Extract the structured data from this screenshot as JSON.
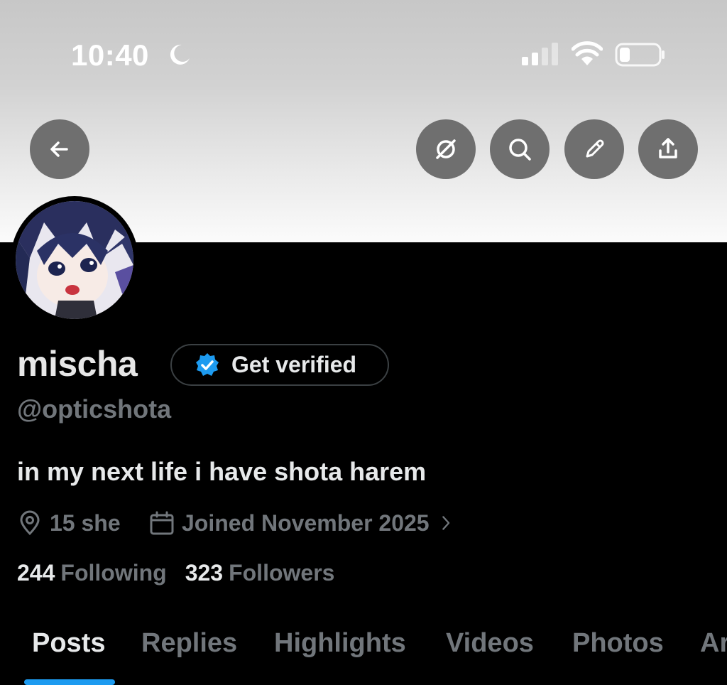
{
  "status_bar": {
    "time": "10:40",
    "moon_icon": "moon-icon",
    "signal_icon": "cellular-signal-icon",
    "wifi_icon": "wifi-icon",
    "battery_icon": "battery-icon",
    "battery_level": 0.25
  },
  "header_actions": {
    "back_icon": "arrow-left-icon",
    "grok_icon": "grok-icon",
    "search_icon": "search-icon",
    "edit_icon": "pencil-icon",
    "share_icon": "share-icon"
  },
  "profile": {
    "display_name": "mischa",
    "get_verified_label": "Get verified",
    "handle": "@opticshota",
    "bio": "in my next life i have shota harem",
    "location": "15 she",
    "joined": "Joined November 2025",
    "following_count": "244",
    "following_label": "Following",
    "followers_count": "323",
    "followers_label": "Followers"
  },
  "tabs": [
    {
      "label": "Posts",
      "active": true
    },
    {
      "label": "Replies",
      "active": false
    },
    {
      "label": "Highlights",
      "active": false
    },
    {
      "label": "Videos",
      "active": false
    },
    {
      "label": "Photos",
      "active": false
    },
    {
      "label": "Ar",
      "active": false
    }
  ],
  "colors": {
    "background": "#000000",
    "accent": "#1d9bf0",
    "secondary_text": "#71767b",
    "primary_text": "#e7e9ea",
    "button_bg": "#6f6f6f"
  }
}
